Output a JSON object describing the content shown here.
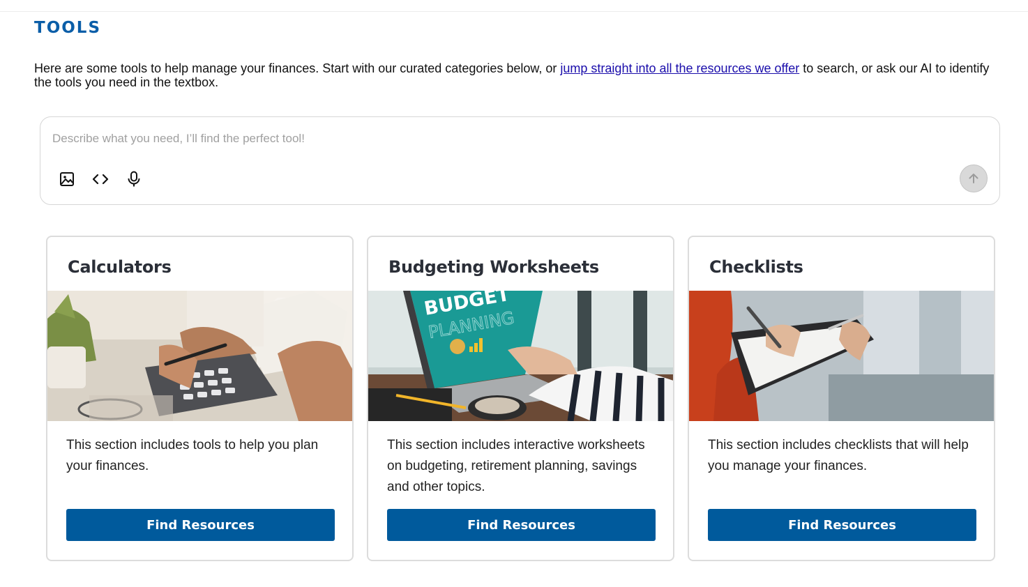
{
  "page": {
    "title": "TOOLS",
    "intro_before": "Here are some tools to help manage your finances. Start with our curated categories below, or ",
    "intro_link": "jump straight into all the resources we offer",
    "intro_after": " to search, or ask our AI to identify the tools you need in the textbox."
  },
  "ai_box": {
    "placeholder": "Describe what you need, I’ll find the perfect tool!",
    "value": "",
    "tools": [
      "image-icon",
      "code-icon",
      "microphone-icon"
    ],
    "send_icon": "arrow-up-icon"
  },
  "cards": [
    {
      "title": "Calculators",
      "image": "photo of hands using a calculator with documents",
      "description": "This section includes tools to help you plan your finances.",
      "button": "Find Resources"
    },
    {
      "title": "Budgeting Worksheets",
      "image": "photo of laptop showing budget planning",
      "image_text_1": "BUDGET",
      "image_text_2": "PLANNING",
      "description": "This section includes interactive worksheets on budgeting, retirement planning, savings and other topics.",
      "button": "Find Resources"
    },
    {
      "title": "Checklists",
      "image": "photo of person writing on a clipboard",
      "description": "This section includes checklists that will help you manage your finances.",
      "button": "Find Resources"
    }
  ],
  "colors": {
    "brand_blue": "#005a9c",
    "title_blue": "#0b5ea8",
    "link": "#1a0dab"
  }
}
